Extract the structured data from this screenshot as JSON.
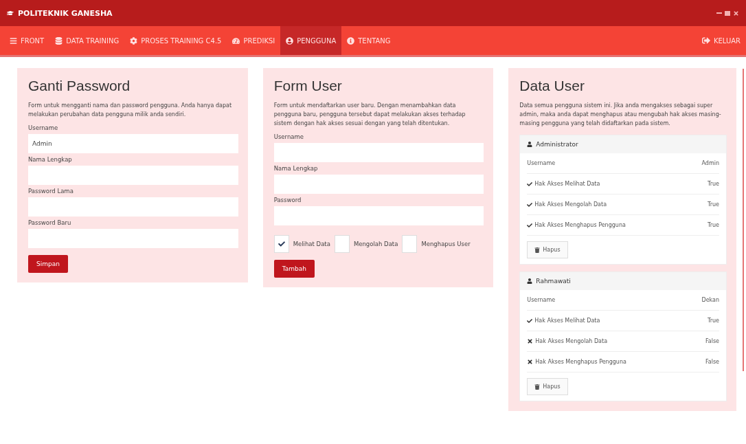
{
  "window": {
    "title": "POLITEKNIK GANESHA"
  },
  "nav": {
    "items": [
      {
        "label": "FRONT",
        "selected": false
      },
      {
        "label": "DATA TRAINING",
        "selected": false
      },
      {
        "label": "PROSES TRAINING C4.5",
        "selected": false
      },
      {
        "label": "PREDIKSI",
        "selected": false
      },
      {
        "label": "PENGGUNA",
        "selected": true
      },
      {
        "label": "TENTANG",
        "selected": false
      }
    ],
    "logout": "KELUAR"
  },
  "change_password": {
    "title": "Ganti Password",
    "description": "Form untuk mengganti nama dan password pengguna. Anda hanya dapat melakukan perubahan data pengguna milik anda sendiri.",
    "fields": [
      {
        "label": "Username",
        "value": "Admin"
      },
      {
        "label": "Nama Lengkap"
      },
      {
        "label": "Password Lama"
      },
      {
        "label": "Password Baru"
      }
    ],
    "button": "Simpan"
  },
  "form_user": {
    "title": "Form User",
    "description": "Form untuk mendaftarkan user baru. Dengan menambahkan data pengguna baru, pengguna tersebut dapat melakukan akses terhadap sistem dengan hak akses sesuai dengan yang telah ditentukan.",
    "fields": [
      {
        "label": "Username"
      },
      {
        "label": "Nama Lengkap"
      },
      {
        "label": "Password"
      }
    ],
    "permissions": [
      {
        "label": "Melihat Data",
        "checked": true
      },
      {
        "label": "Mengolah Data",
        "checked": false
      },
      {
        "label": "Menghapus User",
        "checked": false
      }
    ],
    "button": "Tambah"
  },
  "data_user": {
    "title": "Data User",
    "description": "Data semua pengguna sistem ini. Jika anda mengakses sebagai super admin, maka anda dapat menghapus atau mengubah hak akses masing-masing pengguna yang telah didaftarkan pada sistem.",
    "users": [
      {
        "name": "Administrator",
        "username_label": "Username",
        "username": "Admin",
        "rights": [
          {
            "label": "Hak Akses Melihat Data",
            "granted": true,
            "value": "True"
          },
          {
            "label": "Hak Akses Mengolah Data",
            "granted": true,
            "value": "True"
          },
          {
            "label": "Hak Akses Menghapus Pengguna",
            "granted": true,
            "value": "True"
          }
        ],
        "button": "Hapus"
      },
      {
        "name": "Rahmawati",
        "username_label": "Username",
        "username": "Dekan",
        "rights": [
          {
            "label": "Hak Akses Melihat Data",
            "granted": true,
            "value": "True"
          },
          {
            "label": "Hak Akses Mengolah Data",
            "granted": false,
            "value": "False"
          },
          {
            "label": "Hak Akses Menghapus Pengguna",
            "granted": false,
            "value": "False"
          }
        ],
        "button": "Hapus"
      }
    ]
  }
}
